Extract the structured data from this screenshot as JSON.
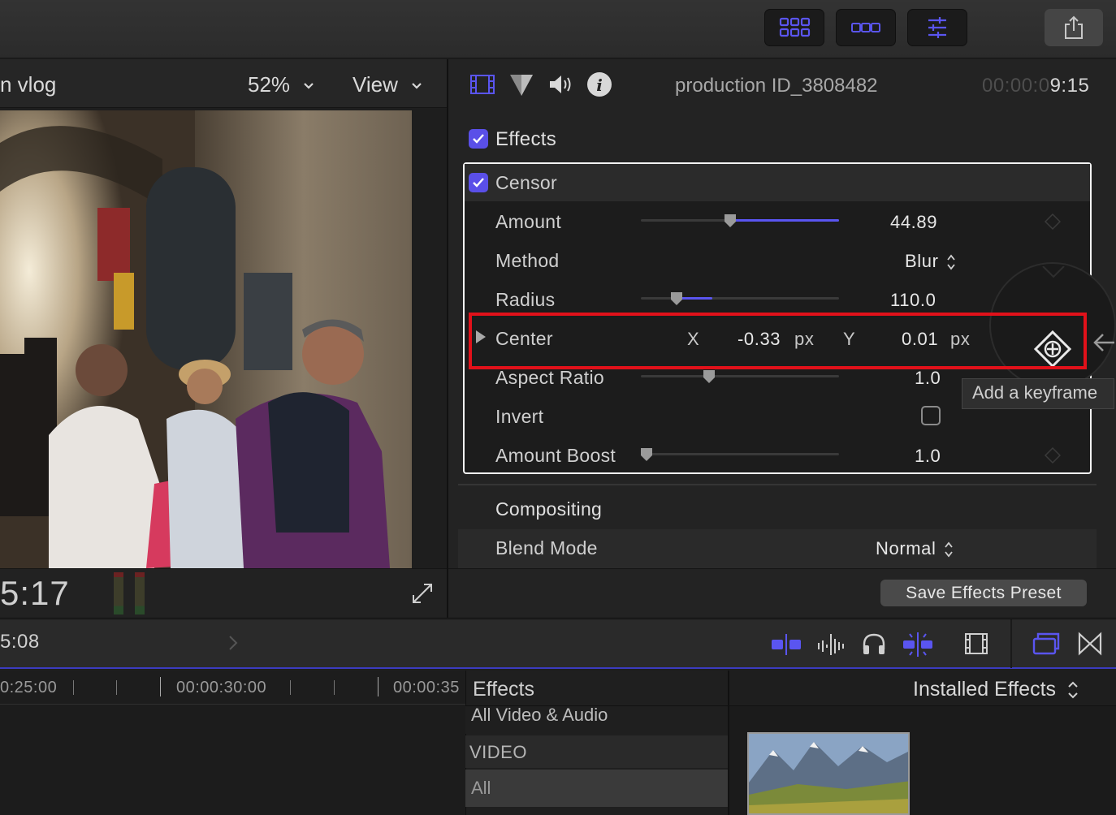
{
  "toolbar": {
    "buttons": [
      "browser-layout-icon",
      "timeline-layout-icon",
      "inspector-icon"
    ],
    "share_icon": "share-icon",
    "accent": "#5a55f0"
  },
  "viewer": {
    "title_fragment": "n vlog",
    "zoom": "52%",
    "view_label": "View",
    "timecode": "5:17"
  },
  "inspector": {
    "tab_icons": [
      "video-inspector-icon",
      "color-inspector-icon",
      "audio-inspector-icon",
      "info-inspector-icon"
    ],
    "clip_name": "production ID_3808482",
    "duration_dim": "00:00:0",
    "duration_bright": "9:15",
    "effects_section": "Effects",
    "effect_name": "Censor",
    "params": {
      "amount": {
        "label": "Amount",
        "value": "44.89",
        "fraction": 0.45
      },
      "method": {
        "label": "Method",
        "value": "Blur"
      },
      "radius": {
        "label": "Radius",
        "value": "110.0",
        "fraction": 0.18
      },
      "center": {
        "label": "Center",
        "x_label": "X",
        "x_value": "-0.33",
        "x_unit": "px",
        "y_label": "Y",
        "y_value": "0.01",
        "y_unit": "px"
      },
      "aspect_ratio": {
        "label": "Aspect Ratio",
        "value": "1.0"
      },
      "invert": {
        "label": "Invert",
        "checked": false
      },
      "amount_boost": {
        "label": "Amount Boost",
        "value": "1.0"
      }
    },
    "compositing": "Compositing",
    "blend_mode_label": "Blend Mode",
    "blend_mode_value": "Normal",
    "tooltip": "Add a keyframe",
    "save_preset": "Save Effects Preset",
    "highlight_color": "#e1111a"
  },
  "timeline": {
    "timecode": "5:08",
    "ruler": [
      "0:25:00",
      "00:00:30:00",
      "00:00:35"
    ]
  },
  "effects_browser": {
    "title": "Effects",
    "filter": "Installed Effects",
    "categories": [
      "All Video & Audio",
      "VIDEO",
      "All"
    ]
  }
}
